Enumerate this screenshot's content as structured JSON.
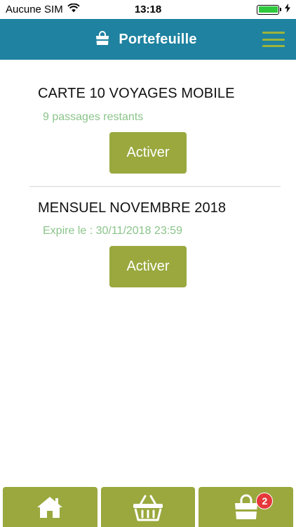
{
  "status_bar": {
    "carrier": "Aucune SIM",
    "time": "13:18"
  },
  "header": {
    "title": "Portefeuille",
    "icon": "shopping-bag-icon",
    "menu_icon": "hamburger-menu-icon"
  },
  "products": [
    {
      "title": "CARTE 10 VOYAGES MOBILE",
      "subtitle": "9 passages restants",
      "button_label": "Activer"
    },
    {
      "title": "MENSUEL NOVEMBRE 2018",
      "subtitle": "Expire le : 30/11/2018 23:59",
      "button_label": "Activer"
    }
  ],
  "bottom_nav": {
    "tabs": [
      {
        "icon": "home-icon"
      },
      {
        "icon": "basket-icon"
      },
      {
        "icon": "shopping-bag-icon",
        "badge": "2"
      }
    ]
  },
  "colors": {
    "header_bg": "#1e82a0",
    "accent_green": "#9aa83e",
    "subtitle_green": "#8bc48a",
    "badge_red": "#e5383b",
    "menu_green": "#9db43c"
  }
}
